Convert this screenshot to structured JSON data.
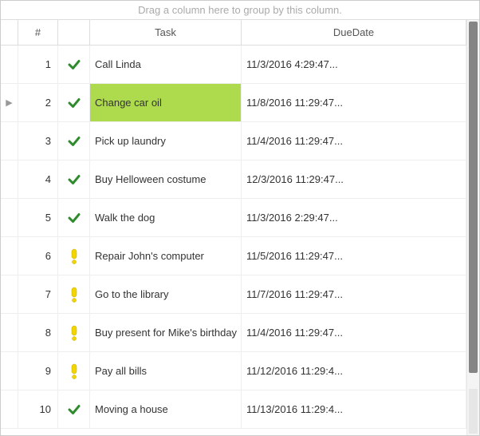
{
  "group_panel_text": "Drag a column here to group by this column.",
  "columns": {
    "num": "#",
    "status": "",
    "task": "Task",
    "due": "DueDate"
  },
  "icons": {
    "check": "check",
    "warn": "warn"
  },
  "rows": [
    {
      "n": "1",
      "status": "check",
      "task": "Call Linda",
      "due": "11/3/2016 4:29:47...",
      "indicator": "",
      "selected": false
    },
    {
      "n": "2",
      "status": "check",
      "task": "Change car oil",
      "due": "11/8/2016 11:29:47...",
      "indicator": "▶",
      "selected": true
    },
    {
      "n": "3",
      "status": "check",
      "task": "Pick up laundry",
      "due": "11/4/2016 11:29:47...",
      "indicator": "",
      "selected": false
    },
    {
      "n": "4",
      "status": "check",
      "task": "Buy Helloween costume",
      "due": "12/3/2016 11:29:47...",
      "indicator": "",
      "selected": false
    },
    {
      "n": "5",
      "status": "check",
      "task": "Walk the dog",
      "due": "11/3/2016 2:29:47...",
      "indicator": "",
      "selected": false
    },
    {
      "n": "6",
      "status": "warn",
      "task": "Repair John's computer",
      "due": "11/5/2016 11:29:47...",
      "indicator": "",
      "selected": false
    },
    {
      "n": "7",
      "status": "warn",
      "task": "Go to the library",
      "due": "11/7/2016 11:29:47...",
      "indicator": "",
      "selected": false
    },
    {
      "n": "8",
      "status": "warn",
      "task": "Buy present for Mike's birthday",
      "due": "11/4/2016 11:29:47...",
      "indicator": "",
      "selected": false
    },
    {
      "n": "9",
      "status": "warn",
      "task": "Pay all bills",
      "due": "11/12/2016 11:29:4...",
      "indicator": "",
      "selected": false
    },
    {
      "n": "10",
      "status": "check",
      "task": "Moving a house",
      "due": "11/13/2016 11:29:4...",
      "indicator": "",
      "selected": false
    }
  ]
}
